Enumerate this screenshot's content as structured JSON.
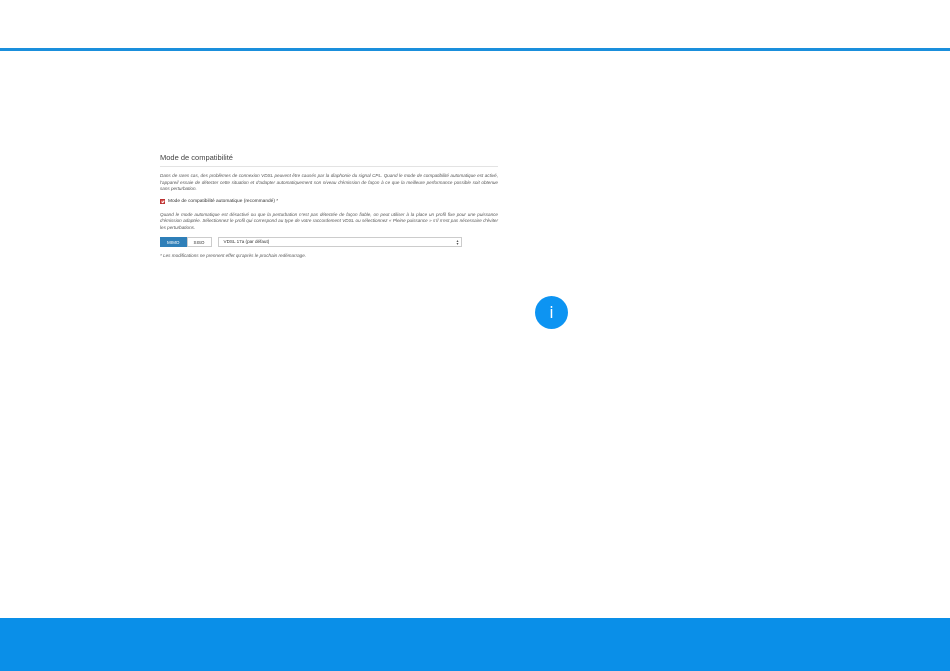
{
  "section": {
    "title": "Mode de compatibilité",
    "intro": "Dans de rares cas, des problèmes de connexion VDSL peuvent être causés par la diaphonie du signal CPL. Quand le mode de compatibilité automatique est activé, l’appareil essaie de détecter cette situation et d’adapter automatiquement son niveau d’émission de façon à ce que la meilleure performance possible soit obtenue sans perturbation.",
    "checkbox_label": "Mode de compatibilité automatique (recommandé) *",
    "checkbox_checked": true,
    "help": "Quand le mode automatique est désactivé ou que la perturbation n’est pas détectée de façon fiable, on peut utiliser à la place un profil fixe pour une puissance d’émission adaptée. Sélectionnez le profil qui correspond au type de votre raccordement VDSL ou sélectionnez « Pleine puissance » s’il n’est pas nécessaire d’éviter les perturbations.",
    "mode_buttons": [
      {
        "label": "MIMO",
        "active": true
      },
      {
        "label": "SISO",
        "active": false
      }
    ],
    "profile_select": {
      "value": "VDSL 17a (par défaut)"
    },
    "note": "* Les modifications ne prennent effet qu’après le prochain redémarrage."
  },
  "info_icon": {
    "glyph": "i"
  },
  "colors": {
    "accent": "#1a8fdc",
    "footer": "#0a8fe8",
    "checkbox": "#d9534f",
    "active_button": "#2f7fb8"
  }
}
